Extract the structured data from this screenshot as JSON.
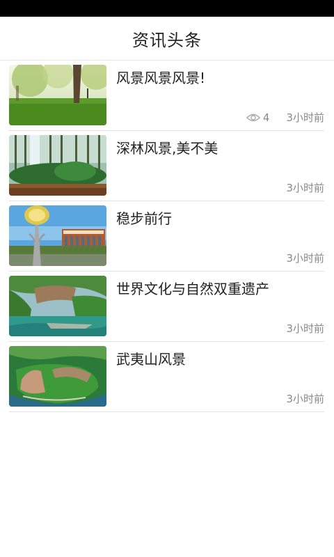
{
  "header": {
    "title": "资讯头条"
  },
  "articles": [
    {
      "title": "风景风景风景!",
      "views": "4",
      "time": "3小时前",
      "thumb_icon": "park-trees-image"
    },
    {
      "title": "深林风景,美不美",
      "time": "3小时前",
      "thumb_icon": "forest-image"
    },
    {
      "title": "稳步前行",
      "time": "3小时前",
      "thumb_icon": "campus-building-image"
    },
    {
      "title": "世界文化与自然双重遗产",
      "time": "3小时前",
      "thumb_icon": "river-cliff-image"
    },
    {
      "title": "武夷山风景",
      "time": "3小时前",
      "thumb_icon": "aerial-mountain-image"
    }
  ],
  "colors": {
    "header_bg": "#ffffff",
    "status_bar": "#000000",
    "meta_text": "#888888",
    "divider": "#e3e3e3"
  }
}
